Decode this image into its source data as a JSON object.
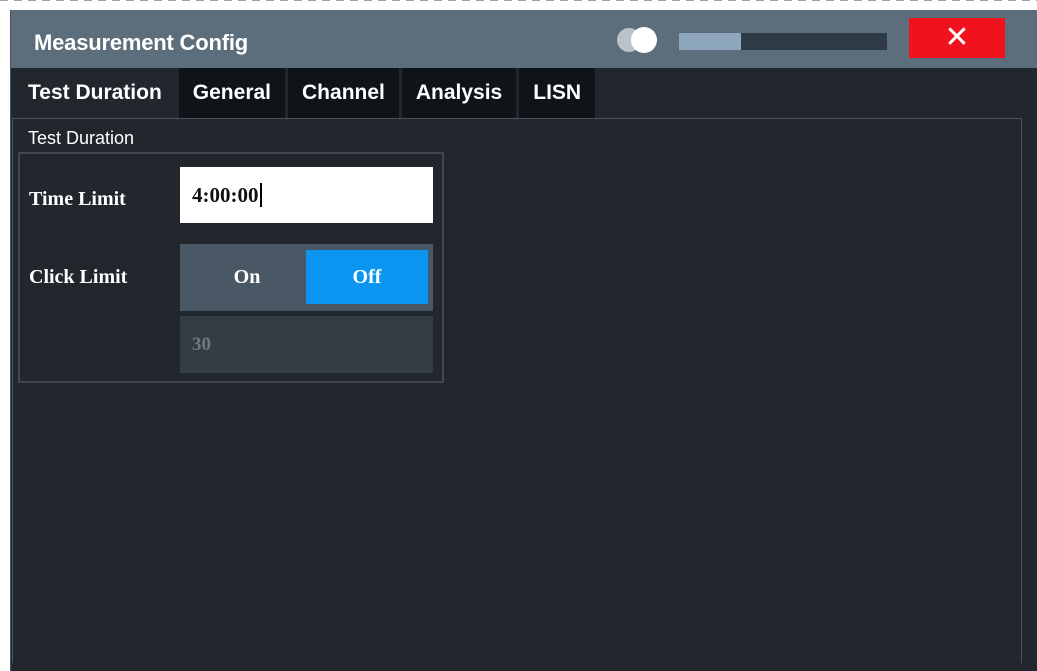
{
  "dialog": {
    "title": "Measurement Config",
    "close_icon": "close-icon",
    "toggle_icon": "toggle-icon",
    "progress_fraction": 0.3
  },
  "tabs": [
    {
      "label": "Test Duration",
      "active": true
    },
    {
      "label": "General",
      "active": false
    },
    {
      "label": "Channel",
      "active": false
    },
    {
      "label": "Analysis",
      "active": false
    },
    {
      "label": "LISN",
      "active": false
    }
  ],
  "test_duration": {
    "group_label": "Test Duration",
    "time_limit": {
      "label": "Time Limit",
      "value": "4:00:00"
    },
    "click_limit": {
      "label": "Click Limit",
      "on_label": "On",
      "off_label": "Off",
      "selected": "Off",
      "value": "30"
    }
  },
  "colors": {
    "titlebar": "#5c6d7b",
    "background": "#22272e",
    "accent": "#0a96f0",
    "close": "#f0131d"
  }
}
